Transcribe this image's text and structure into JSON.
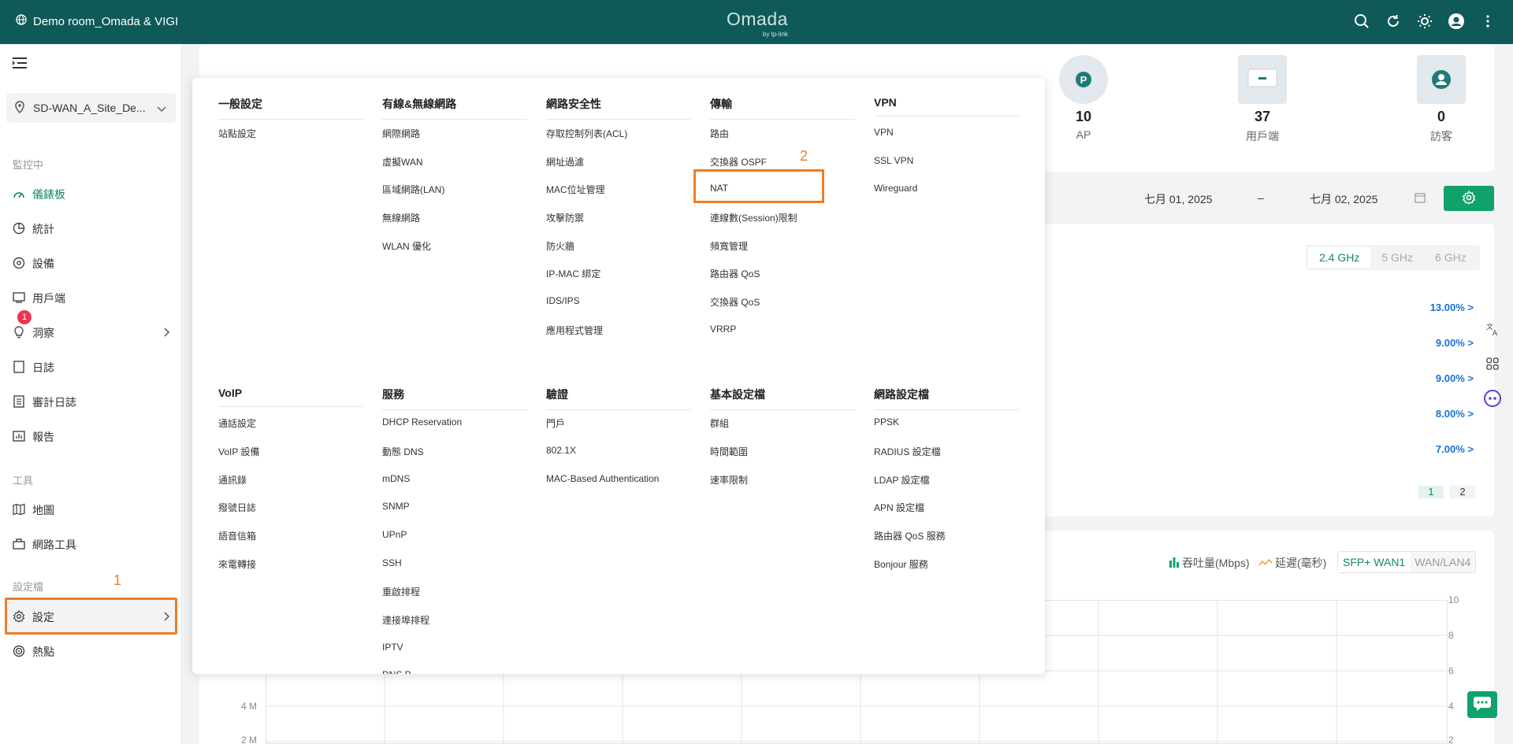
{
  "topbar": {
    "site_label": "Demo room_Omada & VIGI",
    "logo": "Omada",
    "logo_sub": "by tp-link"
  },
  "sidebar": {
    "site_selector": "SD-WAN_A_Site_De...",
    "sections": {
      "monitor": "監控中",
      "tools": "工具",
      "config": "設定檔"
    },
    "items": [
      {
        "label": "儀錶板",
        "icon": "dashboard-icon"
      },
      {
        "label": "統計",
        "icon": "pie-chart-icon"
      },
      {
        "label": "設備",
        "icon": "device-icon"
      },
      {
        "label": "用戶端",
        "icon": "client-icon"
      },
      {
        "label": "洞察",
        "icon": "bulb-icon"
      },
      {
        "label": "日誌",
        "icon": "log-icon",
        "badge": "1"
      },
      {
        "label": "審計日誌",
        "icon": "audit-log-icon"
      },
      {
        "label": "報告",
        "icon": "report-icon"
      },
      {
        "label": "地圖",
        "icon": "map-icon"
      },
      {
        "label": "網路工具",
        "icon": "toolbox-icon"
      },
      {
        "label": "設定",
        "icon": "gear-icon"
      },
      {
        "label": "熱點",
        "icon": "hotspot-icon"
      }
    ]
  },
  "annotations": {
    "one": "1",
    "two": "2"
  },
  "stats": [
    {
      "value": "10",
      "label": "AP"
    },
    {
      "value": "37",
      "label": "用戶端"
    },
    {
      "value": "0",
      "label": "訪客"
    }
  ],
  "dates": {
    "start": "七月 01, 2025",
    "sep": "–",
    "end": "七月 02, 2025"
  },
  "bands": [
    "2.4 GHz",
    "5 GHz",
    "6 GHz"
  ],
  "percents": [
    "13.00% >",
    "9.00% >",
    "9.00% >",
    "8.00% >",
    "7.00% >"
  ],
  "pages": [
    "1",
    "2"
  ],
  "legend": {
    "throughput": "吞吐量(Mbps)",
    "latency": "延遲(毫秒)"
  },
  "wan_tabs": [
    "SFP+ WAN1",
    "WAN/LAN4"
  ],
  "y_right": [
    "10",
    "8",
    "6",
    "4",
    "2"
  ],
  "y_left": [
    "4 M",
    "2 M"
  ],
  "menu": {
    "columns": [
      {
        "title": "一般設定",
        "items": [
          "站點設定"
        ]
      },
      {
        "title": "有線&無線網路",
        "items": [
          "網際網路",
          "虛擬WAN",
          "區域網路(LAN)",
          "無線網路",
          "WLAN 優化"
        ]
      },
      {
        "title": "網路安全性",
        "items": [
          "存取控制列表(ACL)",
          "網址過濾",
          "MAC位址管理",
          "攻擊防禦",
          "防火牆",
          "IP-MAC 綁定",
          "IDS/IPS",
          "應用程式管理"
        ]
      },
      {
        "title": "傳輸",
        "items": [
          "路由",
          "交換器 OSPF",
          "NAT",
          "連線數(Session)限制",
          "頻寬管理",
          "路由器 QoS",
          "交換器 QoS",
          "VRRP"
        ]
      },
      {
        "title": "VPN",
        "items": [
          "VPN",
          "SSL VPN",
          "Wireguard"
        ]
      },
      {
        "title": "VoIP",
        "items": [
          "通話設定",
          "VoIP 設備",
          "通訊錄",
          "撥號日誌",
          "語音信箱",
          "來電轉接"
        ]
      },
      {
        "title": "服務",
        "items": [
          "DHCP Reservation",
          "動態 DNS",
          "mDNS",
          "SNMP",
          "UPnP",
          "SSH",
          "重啟排程",
          "連接埠排程",
          "IPTV",
          "DNS P..."
        ]
      },
      {
        "title": "驗證",
        "items": [
          "門戶",
          "802.1X",
          "MAC-Based Authentication"
        ]
      },
      {
        "title": "基本設定檔",
        "items": [
          "群組",
          "時間範圍",
          "速率限制"
        ]
      },
      {
        "title": "網路設定檔",
        "items": [
          "PPSK",
          "RADIUS 設定檔",
          "LDAP 設定檔",
          "APN 設定檔",
          "路由器 QoS 服務",
          "Bonjour 服務"
        ]
      }
    ]
  }
}
